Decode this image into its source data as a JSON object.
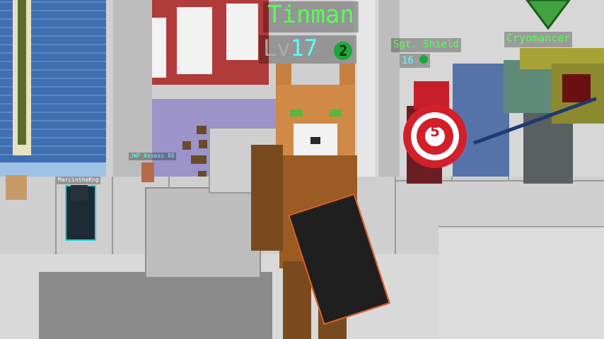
{
  "players": {
    "main": {
      "name": "Tinman",
      "level_prefix": "Lv",
      "level": "17",
      "badge": "2"
    },
    "shield": {
      "name": "Sgt. Shield",
      "level": "16"
    },
    "cryo": {
      "name": "Cryomancer"
    },
    "distant1": {
      "name": "MarcintheKng"
    },
    "distant2": {
      "name": "JWF Assess 88"
    }
  },
  "colors": {
    "name_green": "#55ff55",
    "level_cyan": "#55ffff",
    "level_gray": "#aaaaaa",
    "badge_green": "#1aa83a"
  },
  "icons": {
    "shield_emblem": "number-5-target-icon",
    "cursor_arrow": "green-arrow-icon"
  }
}
